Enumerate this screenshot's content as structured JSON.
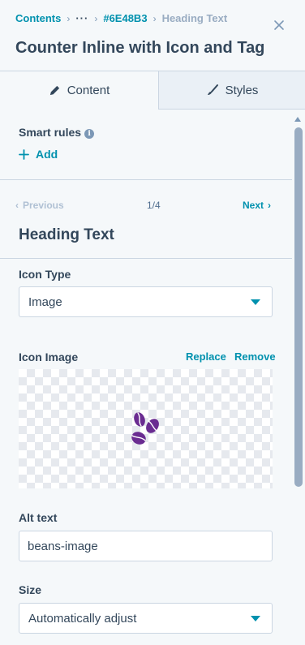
{
  "breadcrumb": {
    "root": "Contents",
    "ellipsis": "···",
    "id": "#6E48B3",
    "current": "Heading Text"
  },
  "title": "Counter Inline with Icon and Tag",
  "tabs": [
    {
      "label": "Content",
      "icon": "pencil-icon",
      "active": true
    },
    {
      "label": "Styles",
      "icon": "brush-icon",
      "active": false
    }
  ],
  "smart_rules": {
    "label": "Smart rules",
    "add_label": "Add"
  },
  "pager": {
    "previous": "Previous",
    "count": "1/4",
    "next": "Next"
  },
  "section_heading": "Heading Text",
  "icon_type": {
    "label": "Icon Type",
    "value": "Image"
  },
  "icon_image": {
    "label": "Icon Image",
    "replace": "Replace",
    "remove": "Remove",
    "image_icon": "coffee-beans-icon",
    "image_color": "#6a2c91"
  },
  "alt_text": {
    "label": "Alt text",
    "value": "beans-image"
  },
  "size": {
    "label": "Size",
    "value": "Automatically adjust"
  },
  "colors": {
    "accent": "#0091ae",
    "text": "#33475b",
    "background": "#f5f8fa"
  }
}
